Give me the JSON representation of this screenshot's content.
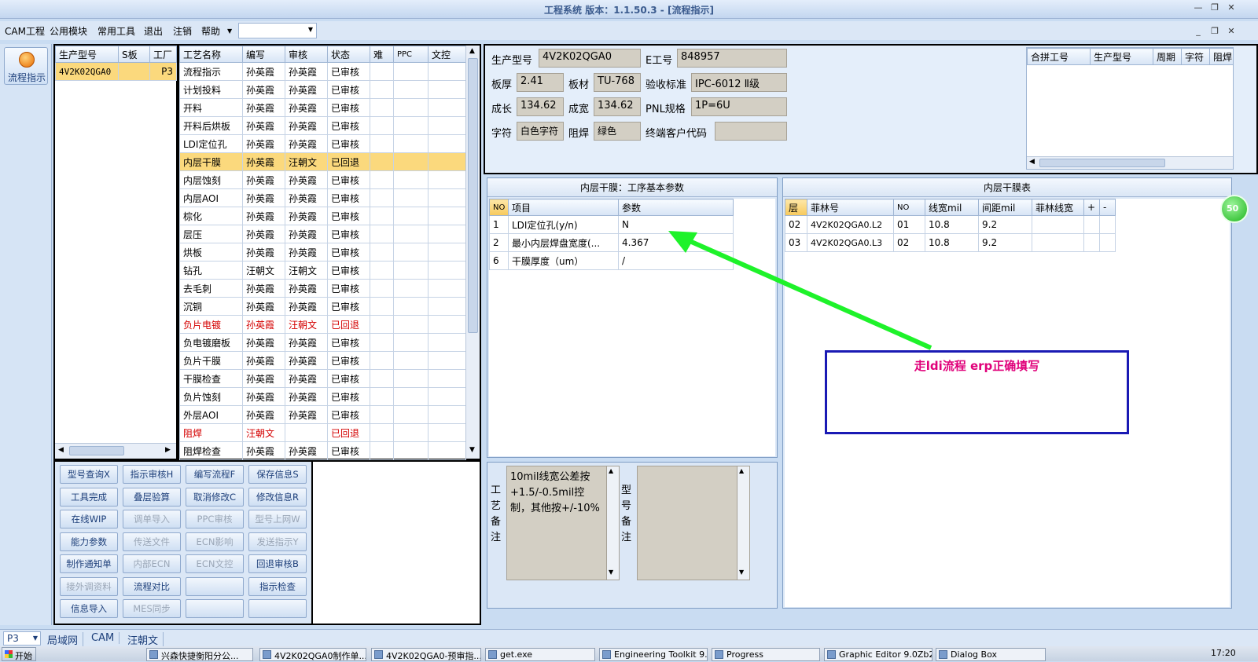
{
  "app": {
    "title": "工程系统   版本：1.1.50.3 - [流程指示]"
  },
  "menu": {
    "items": [
      "CAM工程",
      "公用模块",
      "常用工具",
      "退出",
      "注销",
      "帮助"
    ]
  },
  "sidebar": {
    "flow_button_label": "流程指示"
  },
  "job_list": {
    "headers": [
      "生产型号",
      "S板",
      "工厂"
    ],
    "rows": [
      [
        "4V2K02QGA0",
        "",
        "P3"
      ]
    ]
  },
  "process_table": {
    "headers": [
      "工艺名称",
      "编写",
      "审核",
      "状态",
      "难",
      "PPC",
      "文控"
    ],
    "rows": [
      {
        "cells": [
          "流程指示",
          "孙英霞",
          "孙英霞",
          "已审核",
          "",
          "",
          ""
        ],
        "style": ""
      },
      {
        "cells": [
          "计划投料",
          "孙英霞",
          "孙英霞",
          "已审核",
          "",
          "",
          ""
        ],
        "style": ""
      },
      {
        "cells": [
          "开料",
          "孙英霞",
          "孙英霞",
          "已审核",
          "",
          "",
          ""
        ],
        "style": ""
      },
      {
        "cells": [
          "开料后烘板",
          "孙英霞",
          "孙英霞",
          "已审核",
          "",
          "",
          ""
        ],
        "style": ""
      },
      {
        "cells": [
          "LDI定位孔",
          "孙英霞",
          "孙英霞",
          "已审核",
          "",
          "",
          ""
        ],
        "style": ""
      },
      {
        "cells": [
          "内层干膜",
          "孙英霞",
          "汪朝文",
          "已回退",
          "",
          "",
          ""
        ],
        "style": "hl"
      },
      {
        "cells": [
          "内层蚀刻",
          "孙英霞",
          "孙英霞",
          "已审核",
          "",
          "",
          ""
        ],
        "style": ""
      },
      {
        "cells": [
          "内层AOI",
          "孙英霞",
          "孙英霞",
          "已审核",
          "",
          "",
          ""
        ],
        "style": ""
      },
      {
        "cells": [
          "棕化",
          "孙英霞",
          "孙英霞",
          "已审核",
          "",
          "",
          ""
        ],
        "style": ""
      },
      {
        "cells": [
          "层压",
          "孙英霞",
          "孙英霞",
          "已审核",
          "",
          "",
          ""
        ],
        "style": ""
      },
      {
        "cells": [
          "烘板",
          "孙英霞",
          "孙英霞",
          "已审核",
          "",
          "",
          ""
        ],
        "style": ""
      },
      {
        "cells": [
          "钻孔",
          "汪朝文",
          "汪朝文",
          "已审核",
          "",
          "",
          ""
        ],
        "style": ""
      },
      {
        "cells": [
          "去毛刺",
          "孙英霞",
          "孙英霞",
          "已审核",
          "",
          "",
          ""
        ],
        "style": ""
      },
      {
        "cells": [
          "沉铜",
          "孙英霞",
          "孙英霞",
          "已审核",
          "",
          "",
          ""
        ],
        "style": ""
      },
      {
        "cells": [
          "负片电镀",
          "孙英霞",
          "汪朝文",
          "已回退",
          "",
          "",
          ""
        ],
        "style": "red"
      },
      {
        "cells": [
          "负电镀磨板",
          "孙英霞",
          "孙英霞",
          "已审核",
          "",
          "",
          ""
        ],
        "style": ""
      },
      {
        "cells": [
          "负片干膜",
          "孙英霞",
          "孙英霞",
          "已审核",
          "",
          "",
          ""
        ],
        "style": ""
      },
      {
        "cells": [
          "干膜检查",
          "孙英霞",
          "孙英霞",
          "已审核",
          "",
          "",
          ""
        ],
        "style": ""
      },
      {
        "cells": [
          "负片蚀刻",
          "孙英霞",
          "孙英霞",
          "已审核",
          "",
          "",
          ""
        ],
        "style": ""
      },
      {
        "cells": [
          "外层AOI",
          "孙英霞",
          "孙英霞",
          "已审核",
          "",
          "",
          ""
        ],
        "style": ""
      },
      {
        "cells": [
          "阻焊",
          "汪朝文",
          "",
          "已回退",
          "",
          "",
          ""
        ],
        "style": "red"
      },
      {
        "cells": [
          "阻焊检查",
          "孙英霞",
          "孙英霞",
          "已审核",
          "",
          "",
          ""
        ],
        "style": ""
      }
    ]
  },
  "action_buttons": [
    {
      "label": "型号查询X",
      "enabled": true
    },
    {
      "label": "指示审核H",
      "enabled": true
    },
    {
      "label": "编写流程F",
      "enabled": true
    },
    {
      "label": "保存信息S",
      "enabled": true
    },
    {
      "label": "工具完成",
      "enabled": true
    },
    {
      "label": "叠层验算",
      "enabled": true
    },
    {
      "label": "取消修改C",
      "enabled": true
    },
    {
      "label": "修改信息R",
      "enabled": true
    },
    {
      "label": "在线WIP",
      "enabled": true
    },
    {
      "label": "调单导入",
      "enabled": false
    },
    {
      "label": "PPC审核",
      "enabled": false
    },
    {
      "label": "型号上网W",
      "enabled": false
    },
    {
      "label": "能力参数",
      "enabled": true
    },
    {
      "label": "传送文件",
      "enabled": false
    },
    {
      "label": "ECN影响",
      "enabled": false
    },
    {
      "label": "发送指示Y",
      "enabled": false
    },
    {
      "label": "制作通知单",
      "enabled": true
    },
    {
      "label": "内部ECN",
      "enabled": false
    },
    {
      "label": "ECN文控",
      "enabled": false
    },
    {
      "label": "回退审核B",
      "enabled": true
    },
    {
      "label": "接外调资料",
      "enabled": false
    },
    {
      "label": "流程对比",
      "enabled": true
    },
    {
      "label": "",
      "enabled": true
    },
    {
      "label": "指示检查",
      "enabled": true
    },
    {
      "label": "信息导入",
      "enabled": true
    },
    {
      "label": "MES同步",
      "enabled": false
    },
    {
      "label": "",
      "enabled": true
    },
    {
      "label": "",
      "enabled": true
    }
  ],
  "info": {
    "model_label": "生产型号",
    "model_value": "4V2K02QGA0",
    "eno_label": "E工号",
    "eno_value": "848957",
    "thick_label": "板厚",
    "thick_value": "2.41",
    "material_label": "板材",
    "material_value": "TU-768",
    "std_label": "验收标准",
    "std_value": "IPC-6012 Ⅱ级",
    "len_label": "成长",
    "len_value": "134.62",
    "wid_label": "成宽",
    "wid_value": "134.62",
    "pnl_label": "PNL规格",
    "pnl_value": "1P=6U",
    "char_label": "字符",
    "char_value": "白色字符",
    "mask_label": "阻焊",
    "mask_value": "绿色",
    "cust_label": "终端客户代码",
    "cust_value": ""
  },
  "merge_table": {
    "headers": [
      "合拼工号",
      "生产型号",
      "周期",
      "字符",
      "阻焊"
    ]
  },
  "params": {
    "title": "内层干膜：工序基本参数",
    "headers": [
      "NO",
      "项目",
      "参数"
    ],
    "rows": [
      [
        "1",
        "LDI定位孔(y/n)",
        "N"
      ],
      [
        "2",
        "最小内层焊盘宽度(...",
        "4.367"
      ],
      [
        "6",
        "干膜厚度（um）",
        "/"
      ]
    ]
  },
  "film_table": {
    "title": "内层干膜表",
    "headers": [
      "层",
      "菲林号",
      "NO",
      "线宽mil",
      "间距mil",
      "菲林线宽",
      "+",
      "-"
    ],
    "rows": [
      [
        "02",
        "4V2K02QGA0.L2",
        "01",
        "10.8",
        "9.2",
        "",
        "",
        ""
      ],
      [
        "03",
        "4V2K02QGA0.L3",
        "02",
        "10.8",
        "9.2",
        "",
        "",
        ""
      ]
    ]
  },
  "annotation": {
    "text": "走ldi流程   erp正确填写",
    "color": "#e0007a",
    "arrow_color": "#1ef22a"
  },
  "remarks": {
    "process_label": "工艺备注",
    "process_text": "10mil线宽公差按+1.5/-0.5mil控制，其他按+/-10%",
    "model_label": "型号备注",
    "model_text": ""
  },
  "badge": {
    "text": "50"
  },
  "status": {
    "factory": "P3",
    "tabs": [
      "局域网",
      "CAM",
      "汪朝文"
    ]
  },
  "taskbar": {
    "start": "开始",
    "tasks": [
      "兴森快捷衡阳分公...",
      "4V2K02QGA0制作单....",
      "4V2K02QGA0-预审指...",
      "get.exe",
      "Engineering Toolkit 9....",
      "Progress",
      "Graphic Editor 9.0Zb2...",
      "Dialog Box"
    ],
    "clock": "17:20"
  }
}
